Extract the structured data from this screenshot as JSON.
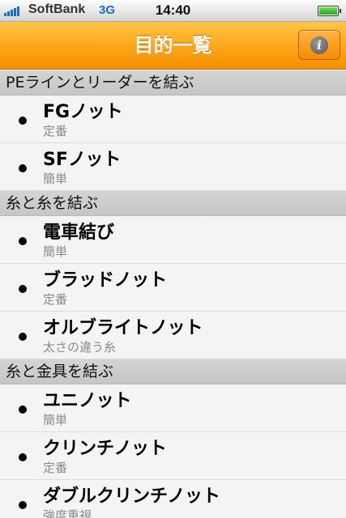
{
  "status_bar": {
    "carrier": "SoftBank",
    "network": "3G",
    "time": "14:40"
  },
  "nav": {
    "title": "目的一覧",
    "info_icon_glyph": "i"
  },
  "sections": [
    {
      "header": "PEラインとリーダーを結ぶ",
      "items": [
        {
          "title": "FGノット",
          "subtitle": "定番"
        },
        {
          "title": "SFノット",
          "subtitle": "簡単"
        }
      ]
    },
    {
      "header": "糸と糸を結ぶ",
      "items": [
        {
          "title": "電車結び",
          "subtitle": "簡単"
        },
        {
          "title": "ブラッドノット",
          "subtitle": "定番"
        },
        {
          "title": "オルブライトノット",
          "subtitle": "太さの違う糸"
        }
      ]
    },
    {
      "header": "糸と金具を結ぶ",
      "items": [
        {
          "title": "ユニノット",
          "subtitle": "簡単"
        },
        {
          "title": "クリンチノット",
          "subtitle": "定番"
        },
        {
          "title": "ダブルクリンチノット",
          "subtitle": "強度重視"
        }
      ]
    }
  ],
  "colors": {
    "nav_orange": "#ffa81c",
    "signal_blue": "#1a6dd1",
    "battery_green": "#2aa31a"
  }
}
